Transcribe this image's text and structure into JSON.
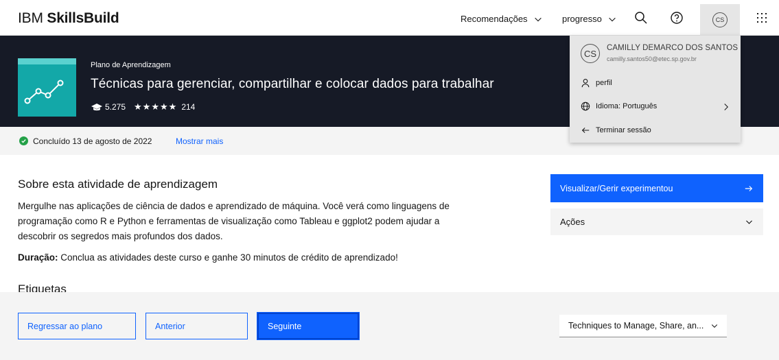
{
  "header": {
    "logo_prefix": "IBM",
    "logo_brand": "SkillsBuild",
    "nav_recommendations": "Recomendações",
    "nav_progress": "progresso",
    "avatar_initials": "CS"
  },
  "hero": {
    "plan_label": "Plano de Aprendizagem",
    "title": "Técnicas para gerenciar, compartilhar e colocar dados para trabalhar",
    "enrolled": "5.275",
    "stars": "★★★★★",
    "rating_count": "214",
    "thumb_color": "#13a8a8"
  },
  "status": {
    "completed_text": "Concluído 13 de agosto de 2022",
    "show_more": "Mostrar mais",
    "check_color": "#24a148"
  },
  "about": {
    "title": "Sobre esta atividade de aprendizagem",
    "description": "Mergulhe nas aplicações de ciência de dados e aprendizado de máquina. Você verá como linguagens de programação como R e Python e ferramentas de visualização como Tableau e ggplot2 podem ajudar a descobrir os segredos mais profundos dos dados.",
    "duration_label": "Duração:",
    "duration_text": " Conclua as atividades deste curso e ganhe 30 minutos de crédito de aprendizado!",
    "tags_title": "Etiquetas"
  },
  "sidebar": {
    "cta_label": "Visualizar/Gerir experimentou",
    "actions_label": "Ações",
    "accent": "#0f62fe"
  },
  "bottom_nav": {
    "back_to_plan": "Regressar ao plano",
    "previous": "Anterior",
    "next": "Seguinte",
    "selected_course": "Techniques to Manage, Share, an..."
  },
  "user_menu": {
    "initials": "CS",
    "name": "CAMILLY DEMARCO DOS SANTOS",
    "email": "camilly.santos50@etec.sp.gov.br",
    "profile": "perfil",
    "language": "Idioma: Português",
    "logout": "Terminar sessão"
  }
}
